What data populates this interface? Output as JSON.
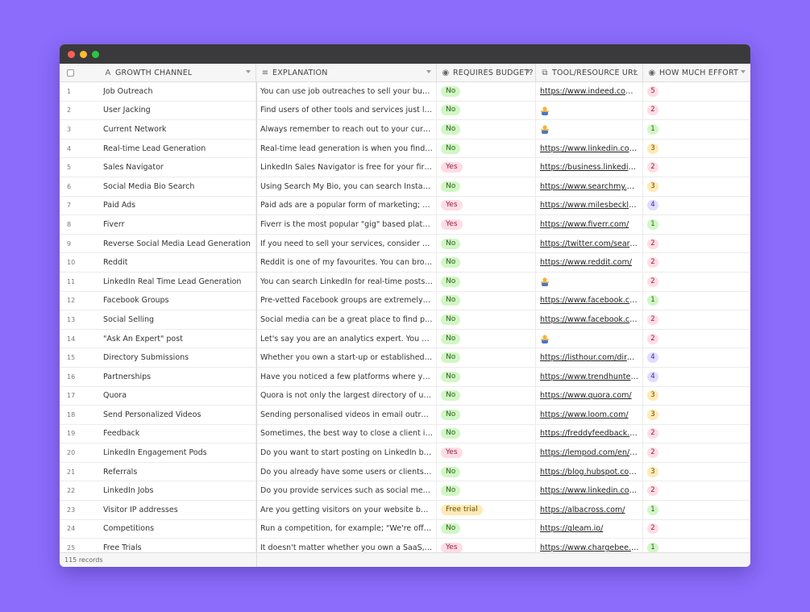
{
  "window": {
    "footer_count": "115 records"
  },
  "columns": {
    "channel": "GROWTH CHANNEL",
    "explanation": "EXPLANATION",
    "budget": "REQUIRES BUDGET?",
    "url": "TOOL/RESOURCE URL",
    "effort": "HOW MUCH EFFORT"
  },
  "colors": {
    "background": "#8b6cfb",
    "no": "#d1f7c4",
    "yes": "#ffdce5",
    "trial": "#ffeab6"
  },
  "rows": [
    {
      "n": "1",
      "channel": "Job Outreach",
      "explanation": "You can use job outreaches to sell your business services",
      "budget": "No",
      "url": "https://www.indeed.com/jobs",
      "effort": "5"
    },
    {
      "n": "2",
      "channel": "User Jacking",
      "explanation": "Find users of other tools and services just like yours",
      "budget": "No",
      "url": "",
      "effort": "2"
    },
    {
      "n": "3",
      "channel": "Current Network",
      "explanation": "Always remember to reach out to your current network",
      "budget": "No",
      "url": "",
      "effort": "1"
    },
    {
      "n": "4",
      "channel": "Real-time Lead Generation",
      "explanation": "Real-time lead generation is when you find a lead",
      "budget": "No",
      "url": "https://www.linkedin.com/search",
      "effort": "3"
    },
    {
      "n": "5",
      "channel": "Sales Navigator",
      "explanation": "LinkedIn Sales Navigator is free for your first month",
      "budget": "Yes",
      "url": "https://business.linkedin.com/sales",
      "effort": "2"
    },
    {
      "n": "6",
      "channel": "Social Media Bio Search",
      "explanation": "Using Search My Bio, you can search Instagram bios",
      "budget": "No",
      "url": "https://www.searchmy.bio/",
      "effort": "3"
    },
    {
      "n": "7",
      "channel": "Paid Ads",
      "explanation": "Paid ads are a popular form of marketing; however",
      "budget": "Yes",
      "url": "https://www.milesbeckler.com/",
      "effort": "4"
    },
    {
      "n": "8",
      "channel": "Fiverr",
      "explanation": "Fiverr is the most popular \"gig\" based platform.",
      "budget": "Yes",
      "url": "https://www.fiverr.com/",
      "effort": "1"
    },
    {
      "n": "9",
      "channel": "Reverse Social Media Lead Generation",
      "explanation": "If you need to sell your services, consider using Twitter",
      "budget": "No",
      "url": "https://twitter.com/search?q=",
      "effort": "2"
    },
    {
      "n": "10",
      "channel": "Reddit",
      "explanation": "Reddit is one of my favourites. You can browse subreddits",
      "budget": "No",
      "url": "https://www.reddit.com/",
      "effort": "2"
    },
    {
      "n": "11",
      "channel": "LinkedIn Real Time Lead Generation",
      "explanation": "You can search LinkedIn for real-time posts. For example",
      "budget": "No",
      "url": "",
      "effort": "2"
    },
    {
      "n": "12",
      "channel": "Facebook Groups",
      "explanation": "Pre-vetted Facebook groups are extremely targeted",
      "budget": "No",
      "url": "https://www.facebook.com/groups",
      "effort": "1"
    },
    {
      "n": "13",
      "channel": "Social Selling",
      "explanation": "Social media can be a great place to find prospects",
      "budget": "No",
      "url": "https://www.facebook.com/",
      "effort": "2"
    },
    {
      "n": "14",
      "channel": "\"Ask An Expert\" post",
      "explanation": "Let's say you are an analytics expert. You could use",
      "budget": "No",
      "url": "",
      "effort": "2"
    },
    {
      "n": "15",
      "channel": "Directory Submissions",
      "explanation": "Whether you own a start-up or established business",
      "budget": "No",
      "url": "https://listhour.com/directories",
      "effort": "4"
    },
    {
      "n": "16",
      "channel": "Partnerships",
      "explanation": "Have you noticed a few platforms where your customers",
      "budget": "No",
      "url": "https://www.trendhunter.com/",
      "effort": "4"
    },
    {
      "n": "17",
      "channel": "Quora",
      "explanation": "Quora is not only the largest directory of user-based",
      "budget": "No",
      "url": "https://www.quora.com/",
      "effort": "3"
    },
    {
      "n": "18",
      "channel": "Send Personalized Videos",
      "explanation": "Sending personalised videos in email outreach and",
      "budget": "No",
      "url": "https://www.loom.com/",
      "effort": "3"
    },
    {
      "n": "19",
      "channel": "Feedback",
      "explanation": "Sometimes, the best way to close a client is to ask",
      "budget": "No",
      "url": "https://freddyfeedback.com/",
      "effort": "2"
    },
    {
      "n": "20",
      "channel": "LinkedIn Engagement Pods",
      "explanation": "Do you want to start posting on LinkedIn but don't",
      "budget": "Yes",
      "url": "https://lempod.com/en/home",
      "effort": "2"
    },
    {
      "n": "21",
      "channel": "Referrals",
      "explanation": "Do you already have some users or clients? You could",
      "budget": "No",
      "url": "https://blog.hubspot.com/sales",
      "effort": "3"
    },
    {
      "n": "22",
      "channel": "LinkedIn Jobs",
      "explanation": "Do you provide services such as social media management",
      "budget": "No",
      "url": "https://www.linkedin.com/jobs",
      "effort": "2"
    },
    {
      "n": "23",
      "channel": "Visitor IP addresses",
      "explanation": "Are you getting visitors on your website but have",
      "budget": "Free trial",
      "url": "https://albacross.com/",
      "effort": "1"
    },
    {
      "n": "24",
      "channel": "Competitions",
      "explanation": "Run a competition, for example; \"We're offering one",
      "budget": "No",
      "url": "https://gleam.io/",
      "effort": "2"
    },
    {
      "n": "25",
      "channel": "Free Trials",
      "explanation": "It doesn't matter whether you own a SaaS, agency",
      "budget": "Yes",
      "url": "https://www.chargebee.com/",
      "effort": "1"
    }
  ]
}
